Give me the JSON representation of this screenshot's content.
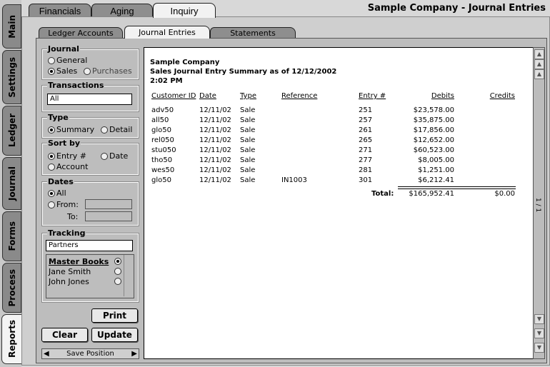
{
  "company_title": "Sample Company - Journal Entries",
  "top_tabs": [
    "Financials",
    "Aging",
    "Inquiry"
  ],
  "side_tabs": [
    "Main",
    "Settings",
    "Ledger",
    "Journal",
    "Forms",
    "Process",
    "Reports"
  ],
  "sub_tabs": [
    "Ledger Accounts",
    "Journal Entries",
    "Statements"
  ],
  "journal": {
    "title": "Journal",
    "options": [
      "General",
      "Sales",
      "Purchases"
    ],
    "selected": "Sales"
  },
  "transactions": {
    "title": "Transactions",
    "value": "All"
  },
  "type": {
    "title": "Type",
    "options": [
      "Summary",
      "Detail"
    ],
    "selected": "Summary"
  },
  "sort_by": {
    "title": "Sort by",
    "options": [
      "Entry #",
      "Date",
      "Account"
    ],
    "selected": "Entry #"
  },
  "dates": {
    "title": "Dates",
    "all_label": "All",
    "from_label": "From:",
    "to_label": "To:",
    "selected": "All"
  },
  "tracking": {
    "title": "Tracking",
    "value": "Partners",
    "list": [
      {
        "name": "Master Books",
        "selected": true
      },
      {
        "name": "Jane Smith",
        "selected": false
      },
      {
        "name": "John Jones",
        "selected": false
      }
    ]
  },
  "buttons": {
    "print": "Print",
    "clear": "Clear",
    "update": "Update",
    "save_position": "Save Position"
  },
  "report": {
    "company": "Sample Company",
    "subtitle": "Sales Journal Entry Summary as of 12/12/2002",
    "time": "2:02 PM",
    "headers": [
      "Customer ID",
      "Date",
      "Type",
      "Reference",
      "Entry #",
      "Debits",
      "Credits"
    ],
    "rows": [
      [
        "adv50",
        "12/11/02",
        "Sale",
        "",
        "251",
        "$23,578.00",
        ""
      ],
      [
        "all50",
        "12/11/02",
        "Sale",
        "",
        "257",
        "$35,875.00",
        ""
      ],
      [
        "glo50",
        "12/11/02",
        "Sale",
        "",
        "261",
        "$17,856.00",
        ""
      ],
      [
        "rel050",
        "12/11/02",
        "Sale",
        "",
        "265",
        "$12,652.00",
        ""
      ],
      [
        "stu050",
        "12/11/02",
        "Sale",
        "",
        "271",
        "$60,523.00",
        ""
      ],
      [
        "tho50",
        "12/11/02",
        "Sale",
        "",
        "277",
        "$8,005.00",
        ""
      ],
      [
        "wes50",
        "12/11/02",
        "Sale",
        "",
        "281",
        "$1,251.00",
        ""
      ],
      [
        "glo50",
        "12/11/02",
        "Sale",
        "IN1003",
        "301",
        "$6,212.41",
        ""
      ]
    ],
    "total_label": "Total:",
    "total_debits": "$165,952.41",
    "total_credits": "$0.00"
  },
  "page_indicator": "1 / 1"
}
